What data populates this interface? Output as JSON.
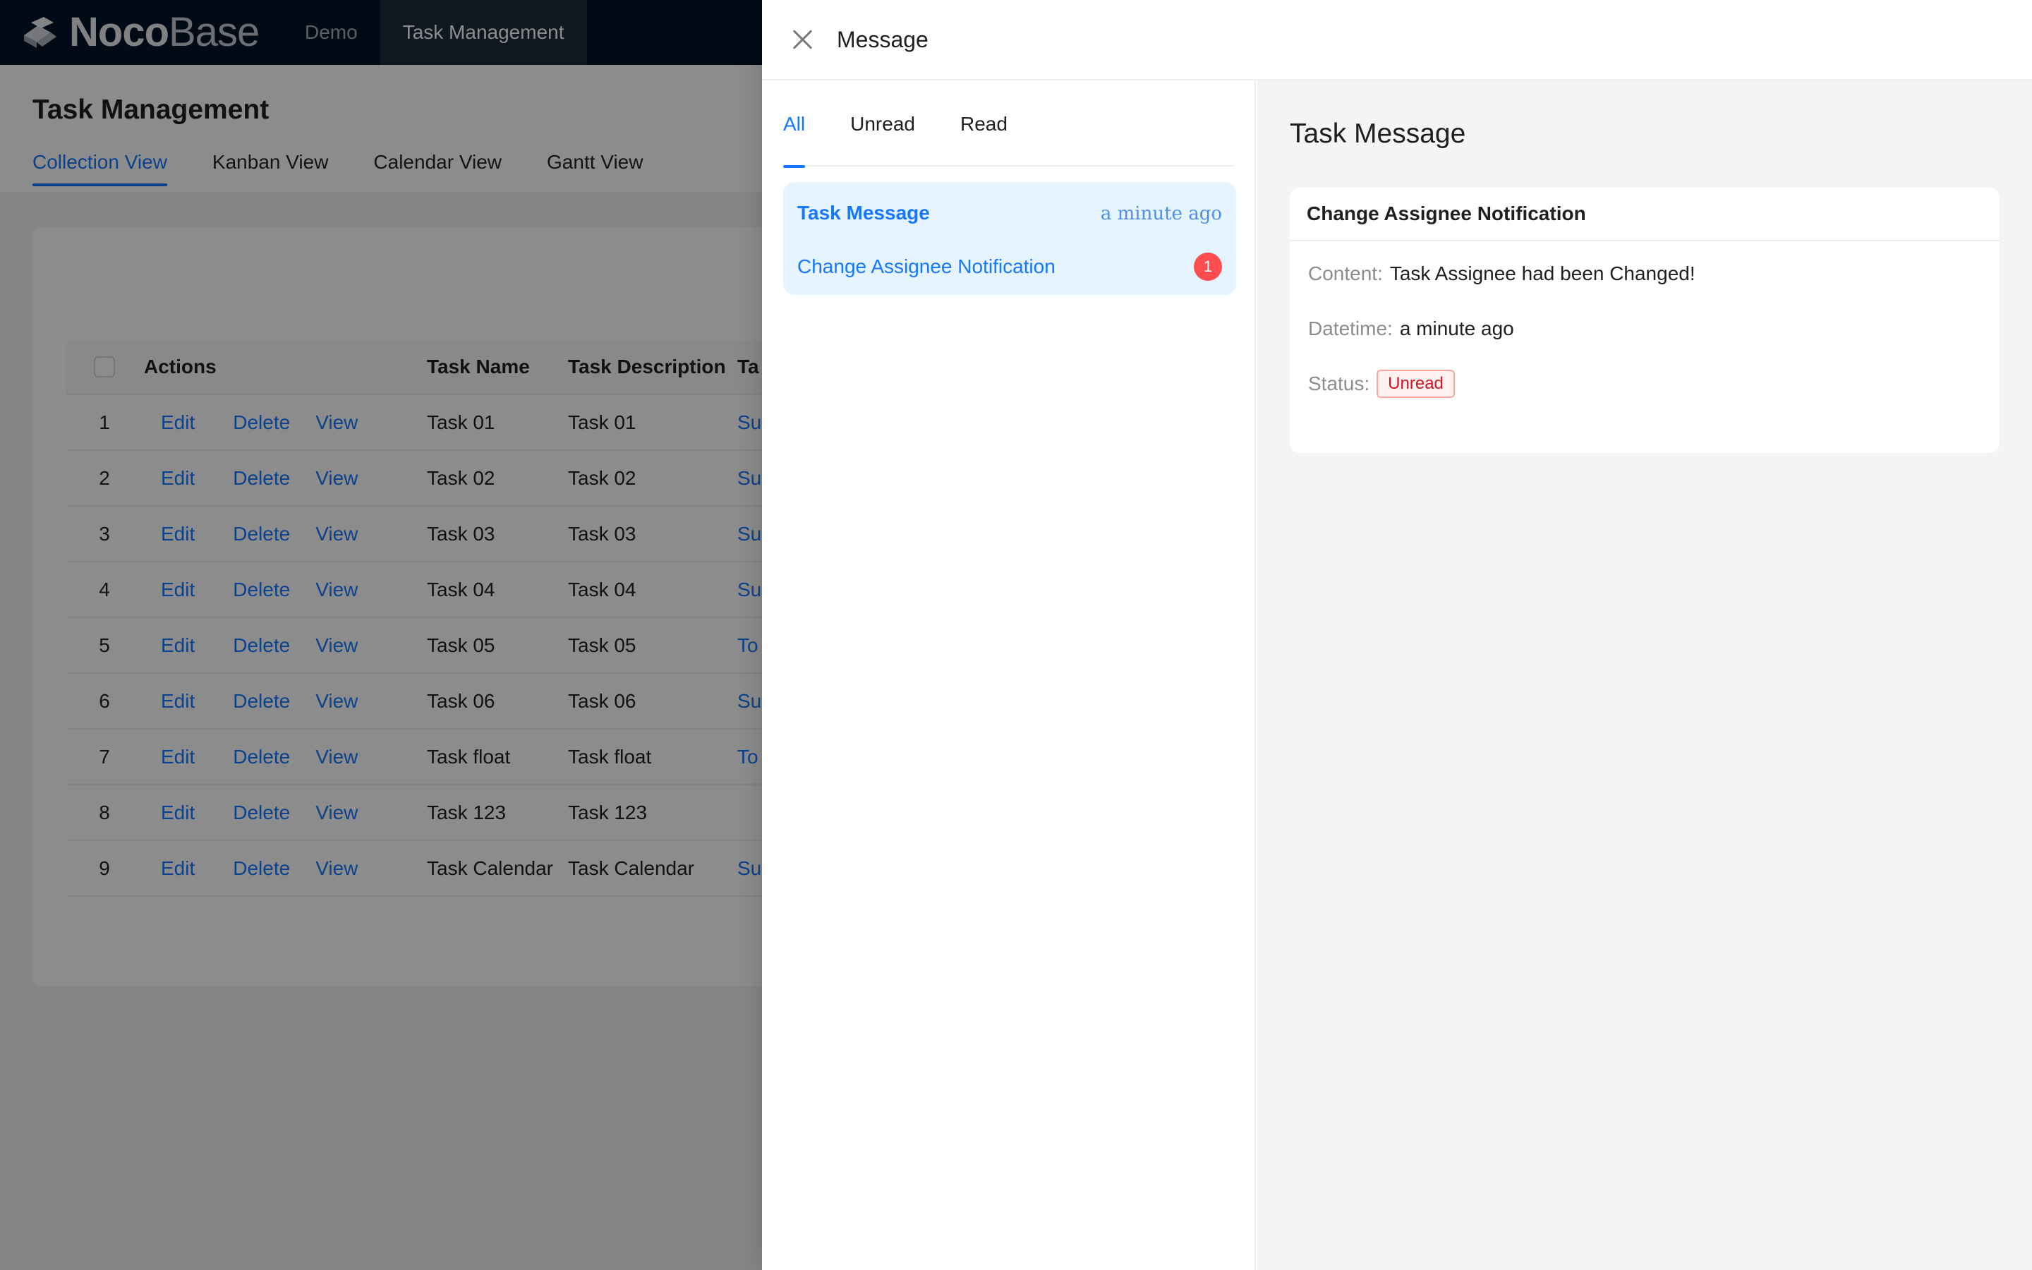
{
  "app": {
    "logo_bold": "Noco",
    "logo_light": "Base",
    "nav": [
      "Demo",
      "Task Management"
    ]
  },
  "page": {
    "title": "Task Management",
    "tabs": [
      "Collection View",
      "Kanban View",
      "Calendar View",
      "Gantt View"
    ]
  },
  "table": {
    "columns": [
      "Actions",
      "Task Name",
      "Task Description",
      "Ta"
    ],
    "actions": {
      "edit": "Edit",
      "delete": "Delete",
      "view": "View"
    },
    "rows": [
      {
        "index": "1",
        "name": "Task 01",
        "desc": "Task 01",
        "more": "Su"
      },
      {
        "index": "2",
        "name": "Task 02",
        "desc": "Task 02",
        "more": "Su"
      },
      {
        "index": "3",
        "name": "Task 03",
        "desc": "Task 03",
        "more": "Su"
      },
      {
        "index": "4",
        "name": "Task 04",
        "desc": "Task 04",
        "more": "Su"
      },
      {
        "index": "5",
        "name": "Task 05",
        "desc": "Task 05",
        "more": "To"
      },
      {
        "index": "6",
        "name": "Task 06",
        "desc": "Task 06",
        "more": "Su"
      },
      {
        "index": "7",
        "name": "Task float",
        "desc": "Task float",
        "more": "To"
      },
      {
        "index": "8",
        "name": "Task 123",
        "desc": "Task 123",
        "more": ""
      },
      {
        "index": "9",
        "name": "Task Calendar",
        "desc": "Task Calendar",
        "more": "Su"
      }
    ]
  },
  "drawer": {
    "title": "Message",
    "tabs": [
      "All",
      "Unread",
      "Read"
    ],
    "message": {
      "title": "Task Message",
      "time": "a minute ago",
      "subtitle": "Change Assignee Notification",
      "badge": "1"
    },
    "detail": {
      "title": "Task Message",
      "card_title": "Change Assignee Notification",
      "content_label": "Content:",
      "content_value": "Task Assignee had been Changed!",
      "datetime_label": "Datetime:",
      "datetime_value": "a minute ago",
      "status_label": "Status:",
      "status_value": "Unread"
    }
  },
  "colors": {
    "primary": "#1677ff",
    "topbar": "#001529",
    "danger": "#ff4d4f"
  }
}
